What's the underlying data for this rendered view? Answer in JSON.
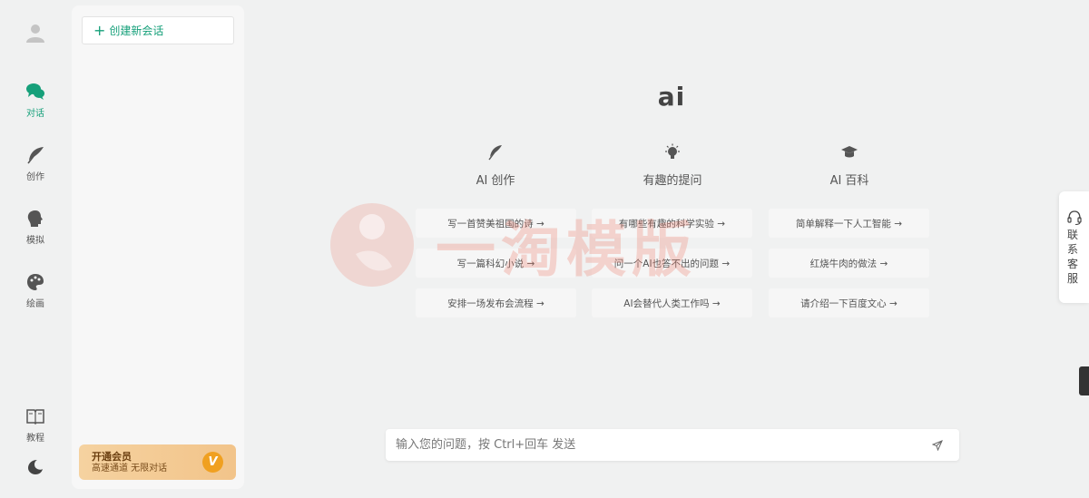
{
  "nav": {
    "items": [
      {
        "label": "对话",
        "icon": "chat-bubbles-icon",
        "active": true
      },
      {
        "label": "创作",
        "icon": "feather-icon",
        "active": false
      },
      {
        "label": "模拟",
        "icon": "head-profile-icon",
        "active": false
      },
      {
        "label": "绘画",
        "icon": "palette-icon",
        "active": false
      }
    ],
    "tutorial_label": "教程"
  },
  "sidebar": {
    "new_chat_label": "创建新会话",
    "vip": {
      "title": "开通会员",
      "subtitle": "高速通道 无限对话",
      "badge": "V"
    }
  },
  "main": {
    "app_title": "ai",
    "categories": [
      {
        "label": "AI 创作",
        "icon": "feather-icon",
        "prompts": [
          "写一首赞美祖国的诗 →",
          "写一篇科幻小说 →",
          "安排一场发布会流程 →"
        ]
      },
      {
        "label": "有趣的提问",
        "icon": "lightbulb-icon",
        "prompts": [
          "有哪些有趣的科学实验 →",
          "问一个AI也答不出的问题 →",
          "AI会替代人类工作吗 →"
        ]
      },
      {
        "label": "AI 百科",
        "icon": "graduation-cap-icon",
        "prompts": [
          "简单解释一下人工智能 →",
          "红烧牛肉的做法 →",
          "请介绍一下百度文心 →"
        ]
      }
    ],
    "watermark": "一淘模版"
  },
  "input": {
    "placeholder": "输入您的问题，按 Ctrl+回车 发送",
    "value": ""
  },
  "contact": {
    "label": "联系客服"
  },
  "colors": {
    "accent": "#16a07a",
    "background": "#f0f1f1",
    "vip_gold": "#f0a020"
  }
}
